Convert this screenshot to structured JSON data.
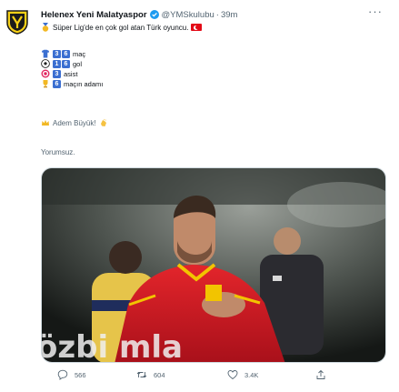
{
  "tweet": {
    "display_name": "Helenex Yeni Malatyaspor",
    "handle": "@YMSkulubu",
    "separator": "·",
    "time": "39m",
    "headline": "Süper Lig'de en çok gol atan Türk oyuncu.",
    "stats": [
      {
        "icon": "jersey-icon",
        "digits": [
          "3",
          "6"
        ],
        "label": "maç"
      },
      {
        "icon": "soccer-ball-icon",
        "digits": [
          "1",
          "6"
        ],
        "label": "gol"
      },
      {
        "icon": "target-icon",
        "digits": [
          "3"
        ],
        "label": "asist"
      },
      {
        "icon": "trophy-icon",
        "digits": [
          "6"
        ],
        "label": "maçın adamı"
      }
    ],
    "player_line": "Adem Büyük!",
    "footer_text": "Yorumsuz.",
    "photo_text": "özbi mla"
  },
  "actions": {
    "reply_count": "566",
    "retweet_count": "604",
    "like_count": "3.4K"
  },
  "colors": {
    "brand_yellow": "#f7d117",
    "brand_dark": "#1b1b1b",
    "keycap_blue": "#3b6fd1",
    "verified_blue": "#1d9bf0",
    "text_secondary": "#536471"
  }
}
